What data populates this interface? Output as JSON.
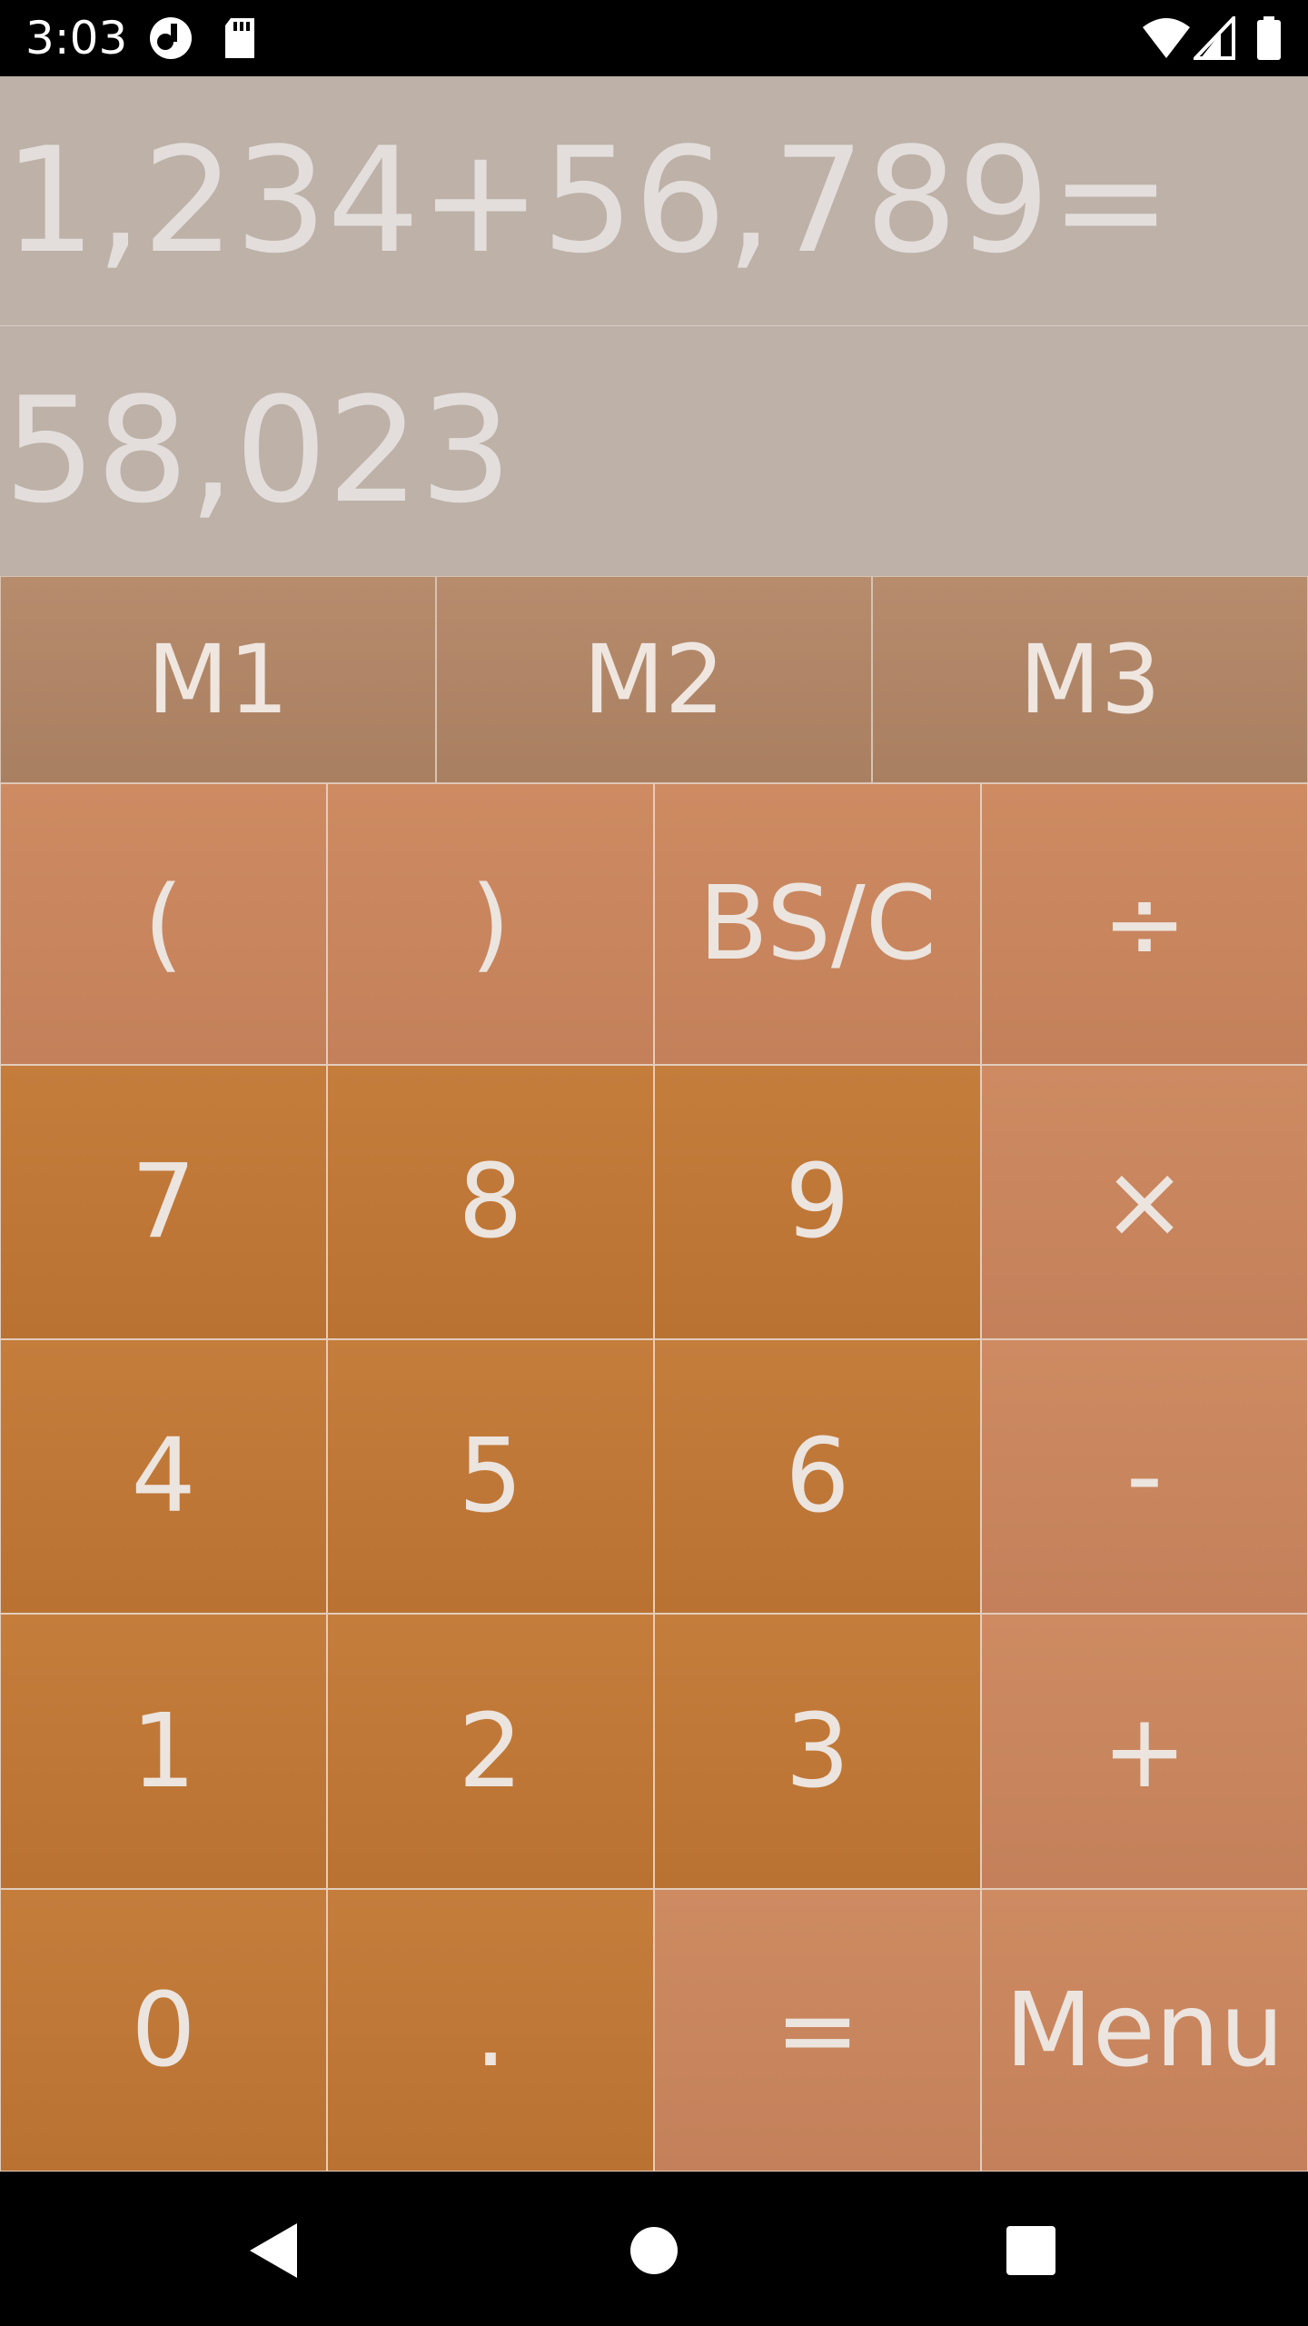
{
  "status_bar": {
    "time": "3:03",
    "left_icons": [
      "app-notification-icon",
      "sd-card-icon"
    ],
    "right_icons": [
      "wifi-icon",
      "cell-signal-icon",
      "battery-icon"
    ]
  },
  "display": {
    "expression": "1,234+56,789=",
    "result": "58,023"
  },
  "memory": [
    {
      "label": "M1"
    },
    {
      "label": "M2"
    },
    {
      "label": "M3"
    }
  ],
  "keys": [
    {
      "label": "(",
      "name": "open-paren",
      "style": "light"
    },
    {
      "label": ")",
      "name": "close-paren",
      "style": "light"
    },
    {
      "label": "BS/C",
      "name": "backspace-clear",
      "style": "light"
    },
    {
      "label": "÷",
      "name": "divide",
      "style": "light"
    },
    {
      "label": "7",
      "name": "digit-7",
      "style": "dark"
    },
    {
      "label": "8",
      "name": "digit-8",
      "style": "dark"
    },
    {
      "label": "9",
      "name": "digit-9",
      "style": "dark"
    },
    {
      "label": "×",
      "name": "multiply",
      "style": "light"
    },
    {
      "label": "4",
      "name": "digit-4",
      "style": "dark"
    },
    {
      "label": "5",
      "name": "digit-5",
      "style": "dark"
    },
    {
      "label": "6",
      "name": "digit-6",
      "style": "dark"
    },
    {
      "label": "-",
      "name": "subtract",
      "style": "light"
    },
    {
      "label": "1",
      "name": "digit-1",
      "style": "dark"
    },
    {
      "label": "2",
      "name": "digit-2",
      "style": "dark"
    },
    {
      "label": "3",
      "name": "digit-3",
      "style": "dark"
    },
    {
      "label": "+",
      "name": "add",
      "style": "light"
    },
    {
      "label": "0",
      "name": "digit-0",
      "style": "dark"
    },
    {
      "label": ".",
      "name": "decimal-point",
      "style": "dark"
    },
    {
      "label": "=",
      "name": "equals",
      "style": "light"
    },
    {
      "label": "Menu",
      "name": "menu",
      "style": "light"
    }
  ],
  "nav_bar": {
    "icons": [
      "back-icon",
      "home-icon",
      "recents-icon"
    ]
  },
  "colors": {
    "display_bg": "#bdb1a8",
    "memory_bg": "#b08466",
    "key_light": "#c9865e",
    "key_dark": "#bf7737",
    "text": "#ece4de"
  }
}
